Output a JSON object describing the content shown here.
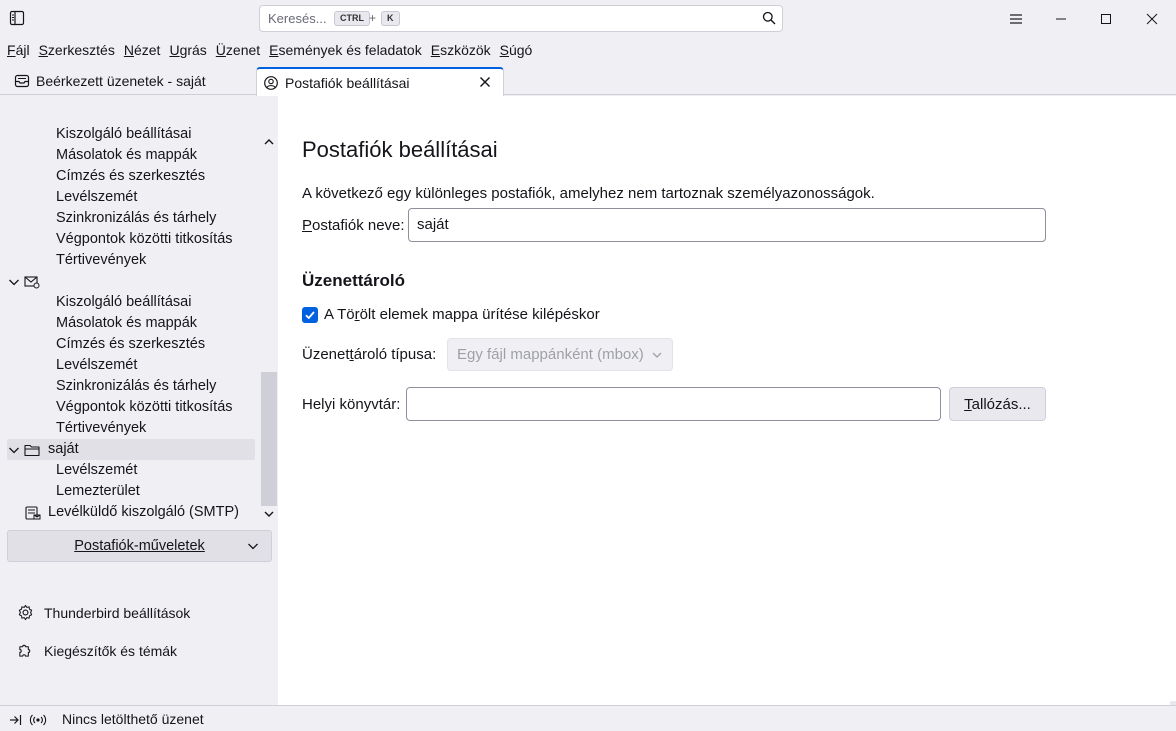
{
  "titlebar": {
    "search_placeholder": "Keresés...",
    "shortcut_key1": "CTRL",
    "shortcut_plus": "+",
    "shortcut_key2": "K"
  },
  "menubar": {
    "items": [
      {
        "label": "Fájl",
        "u": 0
      },
      {
        "label": "Szerkesztés",
        "u": 0
      },
      {
        "label": "Nézet",
        "u": 0
      },
      {
        "label": "Ugrás",
        "u": 0
      },
      {
        "label": "Üzenet",
        "u": 0
      },
      {
        "label": "Események és feladatok",
        "u": 0
      },
      {
        "label": "Eszközök",
        "u": 0
      },
      {
        "label": "Súgó",
        "u": 0
      }
    ]
  },
  "tabs": [
    {
      "label": "Beérkezett üzenetek - saját",
      "active": false
    },
    {
      "label": "Postafiók beállításai",
      "active": true
    }
  ],
  "sidebar": {
    "tree": [
      {
        "type": "child",
        "label": "Kiszolgáló beállításai"
      },
      {
        "type": "child",
        "label": "Másolatok és mappák"
      },
      {
        "type": "child",
        "label": "Címzés és szerkesztés"
      },
      {
        "type": "child",
        "label": "Levélszemét"
      },
      {
        "type": "child",
        "label": "Szinkronizálás és tárhely"
      },
      {
        "type": "child",
        "label": "Végpontok közötti titkosítás"
      },
      {
        "type": "child",
        "label": "Tértivevények"
      },
      {
        "type": "account",
        "label": "",
        "icon": "mail-account-icon"
      },
      {
        "type": "child",
        "label": "Kiszolgáló beállításai"
      },
      {
        "type": "child",
        "label": "Másolatok és mappák"
      },
      {
        "type": "child",
        "label": "Címzés és szerkesztés"
      },
      {
        "type": "child",
        "label": "Levélszemét"
      },
      {
        "type": "child",
        "label": "Szinkronizálás és tárhely"
      },
      {
        "type": "child",
        "label": "Végpontok közötti titkosítás"
      },
      {
        "type": "child",
        "label": "Tértivevények"
      },
      {
        "type": "account",
        "label": "saját",
        "icon": "folder-icon",
        "selected": true
      },
      {
        "type": "child",
        "label": "Levélszemét"
      },
      {
        "type": "child",
        "label": "Lemezterület"
      },
      {
        "type": "smtp",
        "label": "Levélküldő kiszolgáló (SMTP)",
        "icon": "smtp-server-icon"
      }
    ],
    "account_actions_label": "Postafiók-műveletek",
    "settings_link": "Thunderbird beállítások",
    "addons_link": "Kiegészítők és témák"
  },
  "content": {
    "title": "Postafiók beállításai",
    "description": "A következő egy különleges postafiók, amelyhez nem tartoznak személyazonosságok.",
    "account_name_label": "Postafiók neve:",
    "account_name_value": "saját",
    "message_storage_heading": "Üzenettároló",
    "empty_trash_label": "A Törölt elemek mappa ürítése kilépéskor",
    "empty_trash_checked": true,
    "store_type_label": "Üzenettároló típusa:",
    "store_type_value": "Egy fájl mappánként (mbox)",
    "local_dir_label": "Helyi könyvtár:",
    "local_dir_value": "",
    "browse_button": "Tallózás..."
  },
  "statusbar": {
    "text": "Nincs letölthető üzenet"
  },
  "colors": {
    "accent": "#0061e0",
    "background": "#f0f0f4",
    "content_bg": "#ffffff"
  }
}
